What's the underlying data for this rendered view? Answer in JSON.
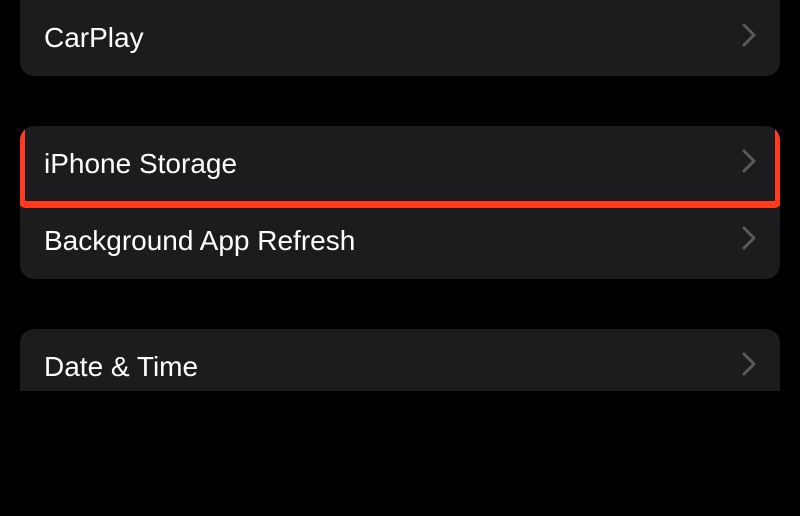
{
  "groups": [
    {
      "items": [
        {
          "id": "carplay",
          "label": "CarPlay",
          "highlighted": false
        }
      ]
    },
    {
      "items": [
        {
          "id": "iphone-storage",
          "label": "iPhone Storage",
          "highlighted": true
        },
        {
          "id": "background-app-refresh",
          "label": "Background App Refresh",
          "highlighted": false
        }
      ]
    },
    {
      "items": [
        {
          "id": "date-time",
          "label": "Date & Time",
          "highlighted": false
        }
      ]
    }
  ]
}
